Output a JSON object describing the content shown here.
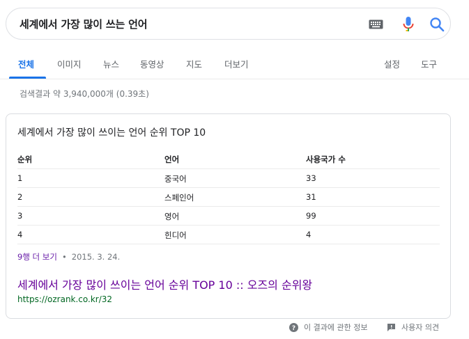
{
  "search": {
    "query": "세계에서 가장 많이 쓰는 언어"
  },
  "tabs": {
    "all": "전체",
    "images": "이미지",
    "news": "뉴스",
    "videos": "동영상",
    "maps": "지도",
    "more": "더보기",
    "settings": "설정",
    "tools": "도구"
  },
  "stats": "검색결과 약 3,940,000개 (0.39초)",
  "snippet": {
    "title": "세계에서 가장 많이 쓰이는 언어 순위 TOP 10",
    "columns": [
      "순위",
      "언어",
      "사용국가 수"
    ],
    "rows": [
      [
        "1",
        "중국어",
        "33"
      ],
      [
        "2",
        "스페인어",
        "31"
      ],
      [
        "3",
        "영어",
        "99"
      ],
      [
        "4",
        "힌디어",
        "4"
      ]
    ],
    "more_rows": "9행 더 보기",
    "separator": "•",
    "date": "2015. 3. 24.",
    "link_title": "세계에서 가장 많이 쓰이는 언어 순위 TOP 10 :: 오즈의 순위왕",
    "url": "https://ozrank.co.kr/32"
  },
  "footer": {
    "about": "이 결과에 관한 정보",
    "feedback": "사용자 의견"
  },
  "colors": {
    "accent": "#1a73e8",
    "visited": "#660099",
    "url_green": "#006621"
  }
}
